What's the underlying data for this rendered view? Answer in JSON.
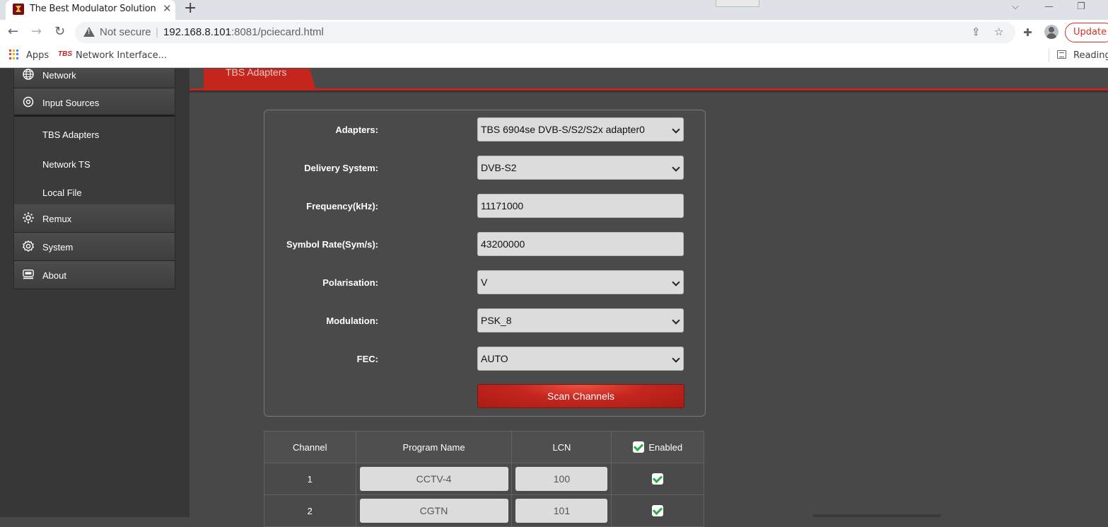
{
  "browser": {
    "tab_title": "The Best Modulator Solution",
    "tab_close": "✕",
    "new_tab": "+",
    "security_label": "Not secure",
    "url_host": "192.168.8.101",
    "url_rest": ":8081/pciecard.html",
    "update_label": "Update",
    "bookmarks": {
      "apps_label": "Apps",
      "favicon_text": "TBS",
      "item_label": "Network Interface...",
      "reading_label": "Reading"
    }
  },
  "sidebar": {
    "items": [
      {
        "label": "Network",
        "icon": "globe-icon"
      },
      {
        "label": "Input Sources",
        "icon": "target-icon"
      },
      {
        "label": "Remux",
        "icon": "gear-dots-icon"
      },
      {
        "label": "System",
        "icon": "cog-icon"
      },
      {
        "label": "About",
        "icon": "monitor-icon"
      }
    ],
    "submenu": [
      {
        "label": "TBS Adapters"
      },
      {
        "label": "Network TS"
      },
      {
        "label": "Local File"
      }
    ]
  },
  "content": {
    "tab_label": "TBS Adapters",
    "form": {
      "adapters_label": "Adapters:",
      "adapters_value": "TBS 6904se DVB-S/S2/S2x adapter0",
      "delivery_label": "Delivery System:",
      "delivery_value": "DVB-S2",
      "frequency_label": "Frequency(kHz):",
      "frequency_value": "11171000",
      "symbol_label": "Symbol Rate(Sym/s):",
      "symbol_value": "43200000",
      "polarisation_label": "Polarisation:",
      "polarisation_value": "V",
      "modulation_label": "Modulation:",
      "modulation_value": "PSK_8",
      "fec_label": "FEC:",
      "fec_value": "AUTO",
      "scan_label": "Scan Channels"
    },
    "table": {
      "headers": {
        "channel": "Channel",
        "program": "Program Name",
        "lcn": "LCN",
        "enabled": "Enabled"
      },
      "rows": [
        {
          "channel": "1",
          "program": "CCTV-4",
          "lcn": "100",
          "enabled": true
        },
        {
          "channel": "2",
          "program": "CGTN",
          "lcn": "101",
          "enabled": true
        }
      ]
    }
  },
  "colors": {
    "accent": "#c4261e",
    "page_bg": "#484848",
    "sidebar_bg": "#373737",
    "check_green": "#2fa84a"
  }
}
